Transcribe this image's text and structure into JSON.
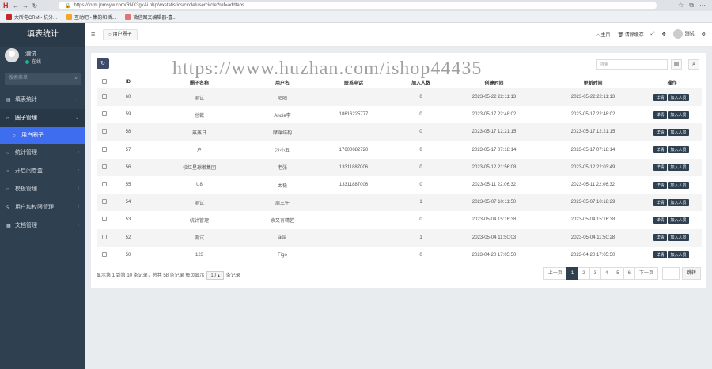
{
  "browser": {
    "url": "https://form.jnmsyw.com/RNX3gkAi.php/wxstatistics/circle/usercircle?ref=addtabs",
    "bookmarks": [
      "大所电CRM - 杭分...",
      "互动吧 - 集的和活...",
      "微信图文编辑器-壹..."
    ]
  },
  "sidebar": {
    "brand": "填表统计",
    "user_name": "测试",
    "user_status": "在线",
    "search_placeholder": "搜索菜单",
    "menu": [
      {
        "label": "填表统计",
        "arrow": "⌄"
      },
      {
        "label": "圈子管理",
        "arrow": "⌄"
      },
      {
        "label": "用户圈子",
        "arrow": ""
      },
      {
        "label": "统计管理",
        "arrow": "‹"
      },
      {
        "label": "开启问卷盒",
        "arrow": "‹"
      },
      {
        "label": "模板管理",
        "arrow": "‹"
      },
      {
        "label": "用户和权限管理",
        "arrow": "‹"
      },
      {
        "label": "文档管理",
        "arrow": "‹"
      }
    ]
  },
  "topbar": {
    "tab_label": "用户圈子",
    "home": "主页",
    "clear_cache": "清除缓存",
    "user": "测试"
  },
  "toolbar": {
    "search_placeholder": "搜索"
  },
  "table": {
    "headers": [
      "ID",
      "圈子名称",
      "用户名",
      "联系电话",
      "加入人数",
      "创建时间",
      "更新时间",
      "操作"
    ],
    "rows": [
      [
        "60",
        "测试",
        "陌陌",
        "",
        "0",
        "2023-05-22 22:11:13",
        "2023-05-22 22:11:13"
      ],
      [
        "59",
        "总裁",
        "Andie李",
        "18616225777",
        "0",
        "2023-05-17 22:48:02",
        "2023-05-17 22:48:02"
      ],
      [
        "58",
        "蒸蒸日",
        "摩课结构",
        "",
        "0",
        "2023-05-17 12:21:15",
        "2023-05-17 12:21:15"
      ],
      [
        "57",
        "户",
        "冷小五",
        "17600082720",
        "0",
        "2023-05-17 07:18:14",
        "2023-05-17 07:18:14"
      ],
      [
        "56",
        "校红星球徽集团",
        "老张",
        "13311887006",
        "0",
        "2023-05-12 21:56:08",
        "2023-05-12 22:03:49"
      ],
      [
        "55",
        "U8",
        "太极",
        "13311887006",
        "0",
        "2023-05-11 22:06:32",
        "2023-05-11 22:06:32"
      ],
      [
        "54",
        "测试",
        "周三午",
        "",
        "1",
        "2023-05-07 10:11:50",
        "2023-05-07 10:18:29"
      ],
      [
        "53",
        "统计管理",
        "余又有精艺",
        "",
        "0",
        "2023-05-04 15:16:38",
        "2023-05-04 15:16:38"
      ],
      [
        "52",
        "测试",
        "ada",
        "",
        "1",
        "2023-05-04 11:50:03",
        "2023-05-04 11:50:28"
      ],
      [
        "50",
        "123",
        "Figo",
        "",
        "0",
        "2023-04-20 17:05:50",
        "2023-04-20 17:05:50"
      ]
    ],
    "btn_detail": "详情",
    "btn_join": "加入人员"
  },
  "footer": {
    "summary": "显示第 1 到第 10 条记录，总共 58 条记录 每页显示",
    "per_page": "10 ▴",
    "suffix": "条记录"
  },
  "pager": {
    "prev": "上一页",
    "pages": [
      "1",
      "2",
      "3",
      "4",
      "5",
      "6"
    ],
    "next": "下一页",
    "go": "跳转"
  },
  "watermark": "https://www.huzhan.com/ishop44435"
}
